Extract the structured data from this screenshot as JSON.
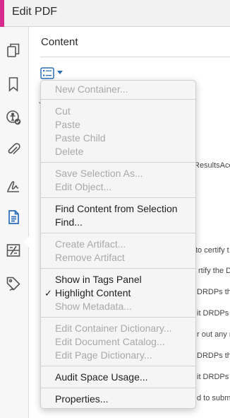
{
  "app": {
    "title": "Edit PDF",
    "accent_color": "#d62a8c"
  },
  "rail": {
    "icons": [
      "pages-icon",
      "bookmark-icon",
      "accessibility-check-icon",
      "attachment-icon",
      "signature-icon",
      "content-icon",
      "compare-icon",
      "tags-icon"
    ],
    "active": "content-icon"
  },
  "panel": {
    "title": "Content",
    "options_icon": "list-options-icon",
    "background_fragments": [
      "f",
      "ResultsAcc",
      "to certify t",
      "rtify the D",
      "DRDPs tha",
      "it DRDPs",
      "r out any r",
      "DRDPs tha",
      "it DRDPs",
      "d to subm"
    ]
  },
  "menu": {
    "items": [
      {
        "label": "New Container...",
        "enabled": false
      },
      {
        "label": "Cut",
        "enabled": false
      },
      {
        "label": "Paste",
        "enabled": false
      },
      {
        "label": "Paste Child",
        "enabled": false
      },
      {
        "label": "Delete",
        "enabled": false
      },
      {
        "label": "Save Selection As...",
        "enabled": false
      },
      {
        "label": "Edit Object...",
        "enabled": false
      },
      {
        "label": "Find Content from Selection",
        "enabled": true
      },
      {
        "label": "Find...",
        "enabled": true
      },
      {
        "label": "Create Artifact...",
        "enabled": false
      },
      {
        "label": "Remove Artifact",
        "enabled": false
      },
      {
        "label": "Show in Tags Panel",
        "enabled": true
      },
      {
        "label": "Highlight Content",
        "enabled": true,
        "checked": true,
        "check_mark": "✓"
      },
      {
        "label": "Show Metadata...",
        "enabled": false
      },
      {
        "label": "Edit Container Dictionary...",
        "enabled": false
      },
      {
        "label": "Edit Document Catalog...",
        "enabled": false
      },
      {
        "label": "Edit Page Dictionary...",
        "enabled": false
      },
      {
        "label": "Audit Space Usage...",
        "enabled": true
      },
      {
        "label": "Properties...",
        "enabled": true
      }
    ]
  }
}
